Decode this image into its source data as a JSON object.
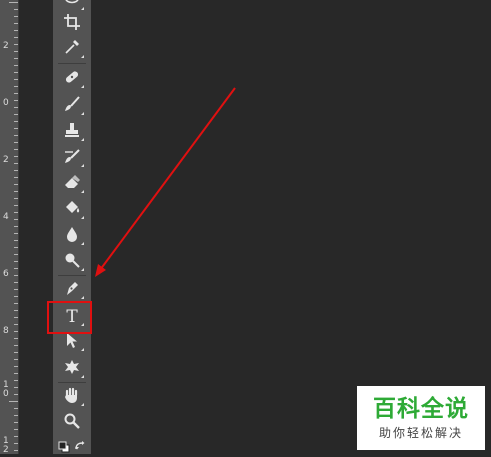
{
  "ruler": {
    "labels": [
      {
        "text": "2"
      },
      {
        "text": "0"
      },
      {
        "text": "2"
      },
      {
        "text": "4"
      },
      {
        "text": "6"
      },
      {
        "text": "8"
      },
      {
        "text": "1\n0"
      },
      {
        "text": "1\n2"
      }
    ]
  },
  "toolbar": {
    "tools": [
      {
        "name": "lasso-tool"
      },
      {
        "name": "crop-tool"
      },
      {
        "name": "eyedropper-tool"
      },
      {
        "name": "spot-healing-brush-tool"
      },
      {
        "name": "brush-tool"
      },
      {
        "name": "clone-stamp-tool"
      },
      {
        "name": "history-brush-tool"
      },
      {
        "name": "eraser-tool"
      },
      {
        "name": "paint-bucket-tool"
      },
      {
        "name": "blur-tool"
      },
      {
        "name": "dodge-tool"
      },
      {
        "name": "pen-tool"
      },
      {
        "name": "type-tool",
        "label": "T"
      },
      {
        "name": "path-selection-tool"
      },
      {
        "name": "custom-shape-tool"
      },
      {
        "name": "hand-tool"
      },
      {
        "name": "zoom-tool"
      },
      {
        "name": "swap-colors-tool"
      }
    ],
    "type_tool_label": "T",
    "highlighted_tool": "type-tool"
  },
  "annotation": {
    "arrow_color": "#e01010",
    "box_color": "#e01010"
  },
  "watermark": {
    "title": "百科全说",
    "subtitle": "助你轻松解决",
    "title_color": "#2eaa36"
  }
}
